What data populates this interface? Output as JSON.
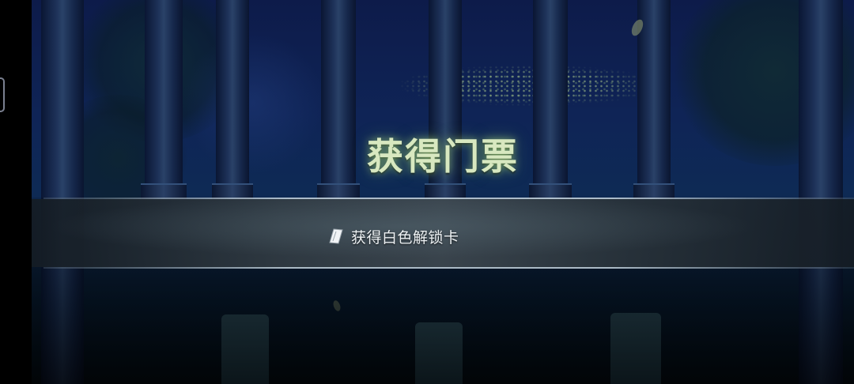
{
  "screen": {
    "title": "获得门票",
    "reward": {
      "text": "获得白色解锁卡",
      "icon": "white-card-icon"
    }
  },
  "colors": {
    "title": "#d8e8c0",
    "title_glow": "#a8dc78",
    "reward_text": "#eef2f4",
    "sky": "#0f2456",
    "banner": "#3c464e"
  }
}
